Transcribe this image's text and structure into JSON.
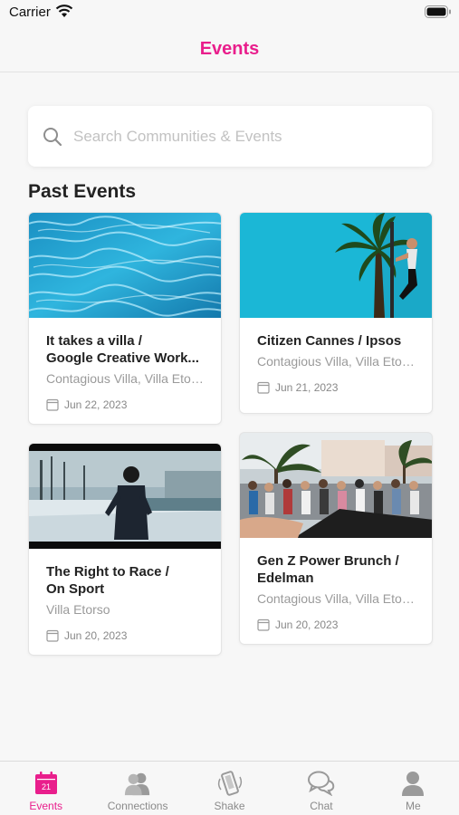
{
  "status_bar": {
    "carrier": "Carrier"
  },
  "nav": {
    "title": "Events"
  },
  "search": {
    "placeholder": "Search Communities & Events"
  },
  "section": {
    "title": "Past Events"
  },
  "events": [
    {
      "title_line1": "It takes a villa /",
      "title_line2": "Google Creative Work...",
      "location": "Contagious Villa, Villa Etors...",
      "date": "Jun 22, 2023",
      "image": "pool-water"
    },
    {
      "title_line1": "Citizen Cannes / Ipsos",
      "title_line2": "",
      "location": "Contagious Villa, Villa Etors...",
      "date": "Jun 21, 2023",
      "image": "palm-tree-climber"
    },
    {
      "title_line1": "The Right to Race /",
      "title_line2": "On Sport",
      "location": "Villa Etorso",
      "date": "Jun 20, 2023",
      "image": "runner-snow"
    },
    {
      "title_line1": "Gen Z Power Brunch /",
      "title_line2": "Edelman",
      "location": "Contagious Villa, Villa Etors...",
      "date": "Jun 20, 2023",
      "image": "crowd-street"
    }
  ],
  "tabs": [
    {
      "label": "Events",
      "icon": "calendar-icon",
      "badge": "21",
      "active": true
    },
    {
      "label": "Connections",
      "icon": "people-icon",
      "active": false
    },
    {
      "label": "Shake",
      "icon": "shake-phone-icon",
      "active": false
    },
    {
      "label": "Chat",
      "icon": "chat-bubbles-icon",
      "active": false
    },
    {
      "label": "Me",
      "icon": "person-icon",
      "active": false
    }
  ],
  "colors": {
    "accent": "#e91e8c",
    "inactive": "#8a8a8a"
  }
}
